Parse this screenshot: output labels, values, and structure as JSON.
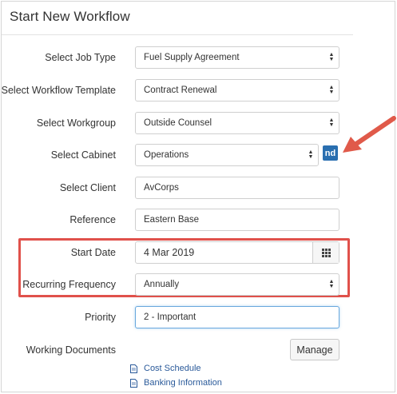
{
  "panel": {
    "title": "Start New Workflow"
  },
  "fields": {
    "job_type": {
      "label": "Select Job Type",
      "value": "Fuel Supply Agreement"
    },
    "workflow_template": {
      "label": "Select Workflow Template",
      "value": "Contract Renewal"
    },
    "workgroup": {
      "label": "Select Workgroup",
      "value": "Outside Counsel"
    },
    "cabinet": {
      "label": "Select Cabinet",
      "value": "Operations",
      "side_button": "nd"
    },
    "client": {
      "label": "Select Client",
      "value": "AvCorps"
    },
    "reference": {
      "label": "Reference",
      "value": "Eastern Base"
    },
    "start_date": {
      "label": "Start Date",
      "value": "4 Mar 2019"
    },
    "recurring_frequency": {
      "label": "Recurring Frequency",
      "value": "Annually"
    },
    "priority": {
      "label": "Priority",
      "value": "2 - Important"
    },
    "working_documents": {
      "label": "Working Documents",
      "button": "Manage"
    }
  },
  "documents": [
    {
      "name": "Cost Schedule"
    },
    {
      "name": "Banking Information"
    }
  ],
  "annotations": {
    "highlight_color": "#e0514b",
    "arrow_color": "#e05a4a"
  },
  "colors": {
    "accent": "#2a6fb0",
    "link": "#2a5a9a"
  }
}
